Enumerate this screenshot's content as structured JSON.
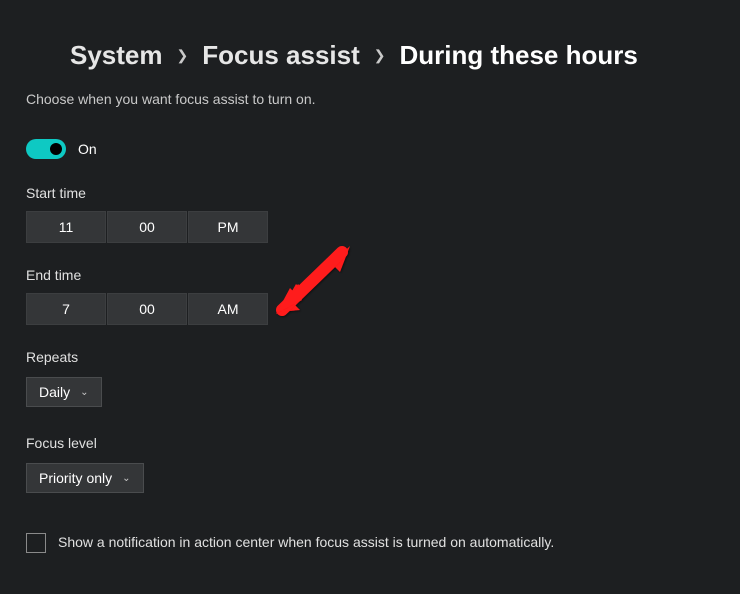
{
  "breadcrumb": {
    "level1": "System",
    "level2": "Focus assist",
    "current": "During these hours"
  },
  "subtitle": "Choose when you want focus assist to turn on.",
  "toggle": {
    "state_label": "On",
    "on": true
  },
  "start_time": {
    "label": "Start time",
    "hour": "11",
    "minute": "00",
    "period": "PM"
  },
  "end_time": {
    "label": "End time",
    "hour": "7",
    "minute": "00",
    "period": "AM"
  },
  "repeats": {
    "label": "Repeats",
    "value": "Daily"
  },
  "focus_level": {
    "label": "Focus level",
    "value": "Priority only"
  },
  "notification_checkbox": {
    "checked": false,
    "label": "Show a notification in action center when focus assist is turned on automatically."
  }
}
